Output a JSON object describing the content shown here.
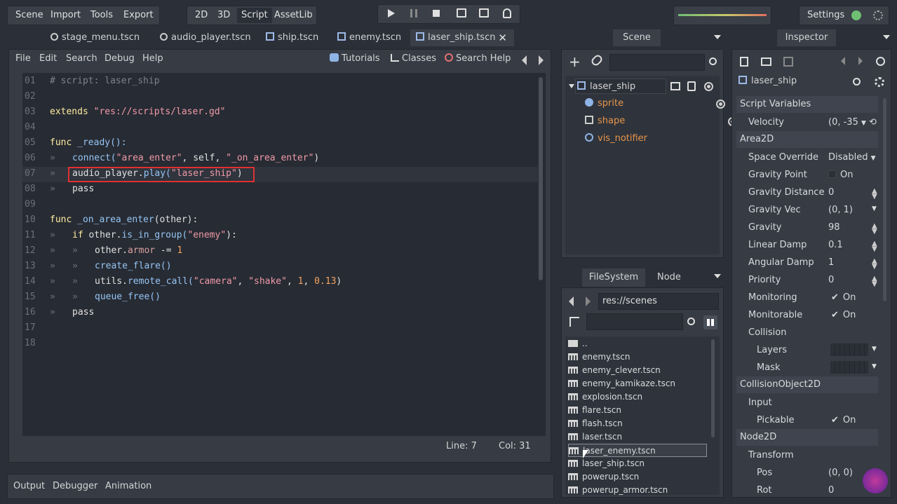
{
  "top_menu": [
    "Scene",
    "Import",
    "Tools",
    "Export"
  ],
  "mode_buttons": [
    "2D",
    "3D",
    "Script",
    "AssetLib"
  ],
  "active_mode": "Script",
  "settings_label": "Settings",
  "scene_tabs": [
    {
      "label": "stage_menu.tscn",
      "icon": "circle-icon"
    },
    {
      "label": "audio_player.tscn",
      "icon": "circle-icon"
    },
    {
      "label": "ship.tscn",
      "icon": "node2d-icon"
    },
    {
      "label": "enemy.tscn",
      "icon": "area2d-icon"
    },
    {
      "label": "laser_ship.tscn",
      "icon": "area2d-icon",
      "active": true
    }
  ],
  "script_menu": [
    "File",
    "Edit",
    "Search",
    "Debug",
    "Help"
  ],
  "script_help": {
    "tutorials": "Tutorials",
    "classes": "Classes",
    "search_help": "Search Help"
  },
  "code": {
    "lines": [
      "01",
      "02",
      "03",
      "04",
      "05",
      "06",
      "07",
      "08",
      "09",
      "10",
      "11",
      "12",
      "13",
      "14",
      "15",
      "16",
      "17",
      "18"
    ],
    "l01": "# script: laser_ship",
    "l03_kw": "extends",
    "l03_str": "\"res://scripts/laser.gd\"",
    "l05_kw": "func",
    "l05_fn": "_ready():",
    "l06_fn": "connect(",
    "l06_s1": "\"area_enter\"",
    "l06_mid": ", self, ",
    "l06_s2": "\"_on_area_enter\"",
    "l06_end": ")",
    "l07_a": "audio_player.",
    "l07_fn": "play(",
    "l07_s": "\"laser_ship\"",
    "l07_end": ")",
    "l08": "pass",
    "l10_kw": "func",
    "l10_fn": "_on_area_enter",
    "l10_rest": "(other):",
    "l11_kw": "if",
    "l11_a": " other.",
    "l11_fn": "is_in_group(",
    "l11_s": "\"enemy\"",
    "l11_end": "):",
    "l12_a": "other.",
    "l12_mem": "armor",
    "l12_op": " -= ",
    "l12_n": "1",
    "l13_fn": "create_flare()",
    "l14_a": "utils.",
    "l14_fn": "remote_call(",
    "l14_s1": "\"camera\"",
    "l14_c": ", ",
    "l14_s2": "\"shake\"",
    "l14_c2": ", ",
    "l14_n1": "1",
    "l14_c3": ", ",
    "l14_n2": "0.13",
    "l14_end": ")",
    "l15_fn": "queue_free()",
    "l16": "pass",
    "tick": "»"
  },
  "status": {
    "line": "Line: 7",
    "col": "Col: 31"
  },
  "bottom_tabs": [
    "Output",
    "Debugger",
    "Animation"
  ],
  "scene_panel": {
    "title": "Scene",
    "nodes": [
      {
        "label": "laser_ship",
        "icon": "area2d-icon",
        "root": true
      },
      {
        "label": "sprite",
        "icon": "sprite-icon"
      },
      {
        "label": "shape",
        "icon": "collision-shape-icon"
      },
      {
        "label": "vis_notifier",
        "icon": "visibility-notifier-icon"
      }
    ]
  },
  "filesystem": {
    "tabs": [
      "FileSystem",
      "Node"
    ],
    "path": "res://scenes",
    "files": [
      "..",
      "enemy.tscn",
      "enemy_clever.tscn",
      "enemy_kamikaze.tscn",
      "explosion.tscn",
      "flare.tscn",
      "flash.tscn",
      "laser.tscn",
      "laser_enemy.tscn",
      "laser_ship.tscn",
      "powerup.tscn",
      "powerup_armor.tscn"
    ],
    "selected": "laser_enemy.tscn"
  },
  "inspector": {
    "title": "Inspector",
    "node": "laser_ship",
    "sections": {
      "script_vars": "Script Variables",
      "area2d": "Area2D",
      "collision_obj": "CollisionObject2D",
      "node2d": "Node2D"
    },
    "props": {
      "velocity": {
        "label": "Velocity",
        "value": "(0, -35"
      },
      "space_override": {
        "label": "Space Override",
        "value": "Disabled"
      },
      "gravity_point": {
        "label": "Gravity Point",
        "value": "On"
      },
      "gravity_distance": {
        "label": "Gravity Distance Sc",
        "value": "0"
      },
      "gravity_vec": {
        "label": "Gravity Vec",
        "value": "(0, 1)"
      },
      "gravity": {
        "label": "Gravity",
        "value": "98"
      },
      "linear_damp": {
        "label": "Linear Damp",
        "value": "0.1"
      },
      "angular_damp": {
        "label": "Angular Damp",
        "value": "1"
      },
      "priority": {
        "label": "Priority",
        "value": "0"
      },
      "monitoring": {
        "label": "Monitoring",
        "value": "On"
      },
      "monitorable": {
        "label": "Monitorable",
        "value": "On"
      },
      "collision": {
        "label": "Collision"
      },
      "layers": {
        "label": "Layers"
      },
      "mask": {
        "label": "Mask"
      },
      "input": {
        "label": "Input"
      },
      "pickable": {
        "label": "Pickable",
        "value": "On"
      },
      "transform": {
        "label": "Transform"
      },
      "pos": {
        "label": "Pos",
        "value": "(0, 0)"
      },
      "rot": {
        "label": "Rot",
        "value": "0"
      }
    }
  },
  "colors": {
    "accent_orange": "#f5a462",
    "node_orange": "#e8944a",
    "highlight_red": "#e03030",
    "bg": "#2b2f37"
  }
}
